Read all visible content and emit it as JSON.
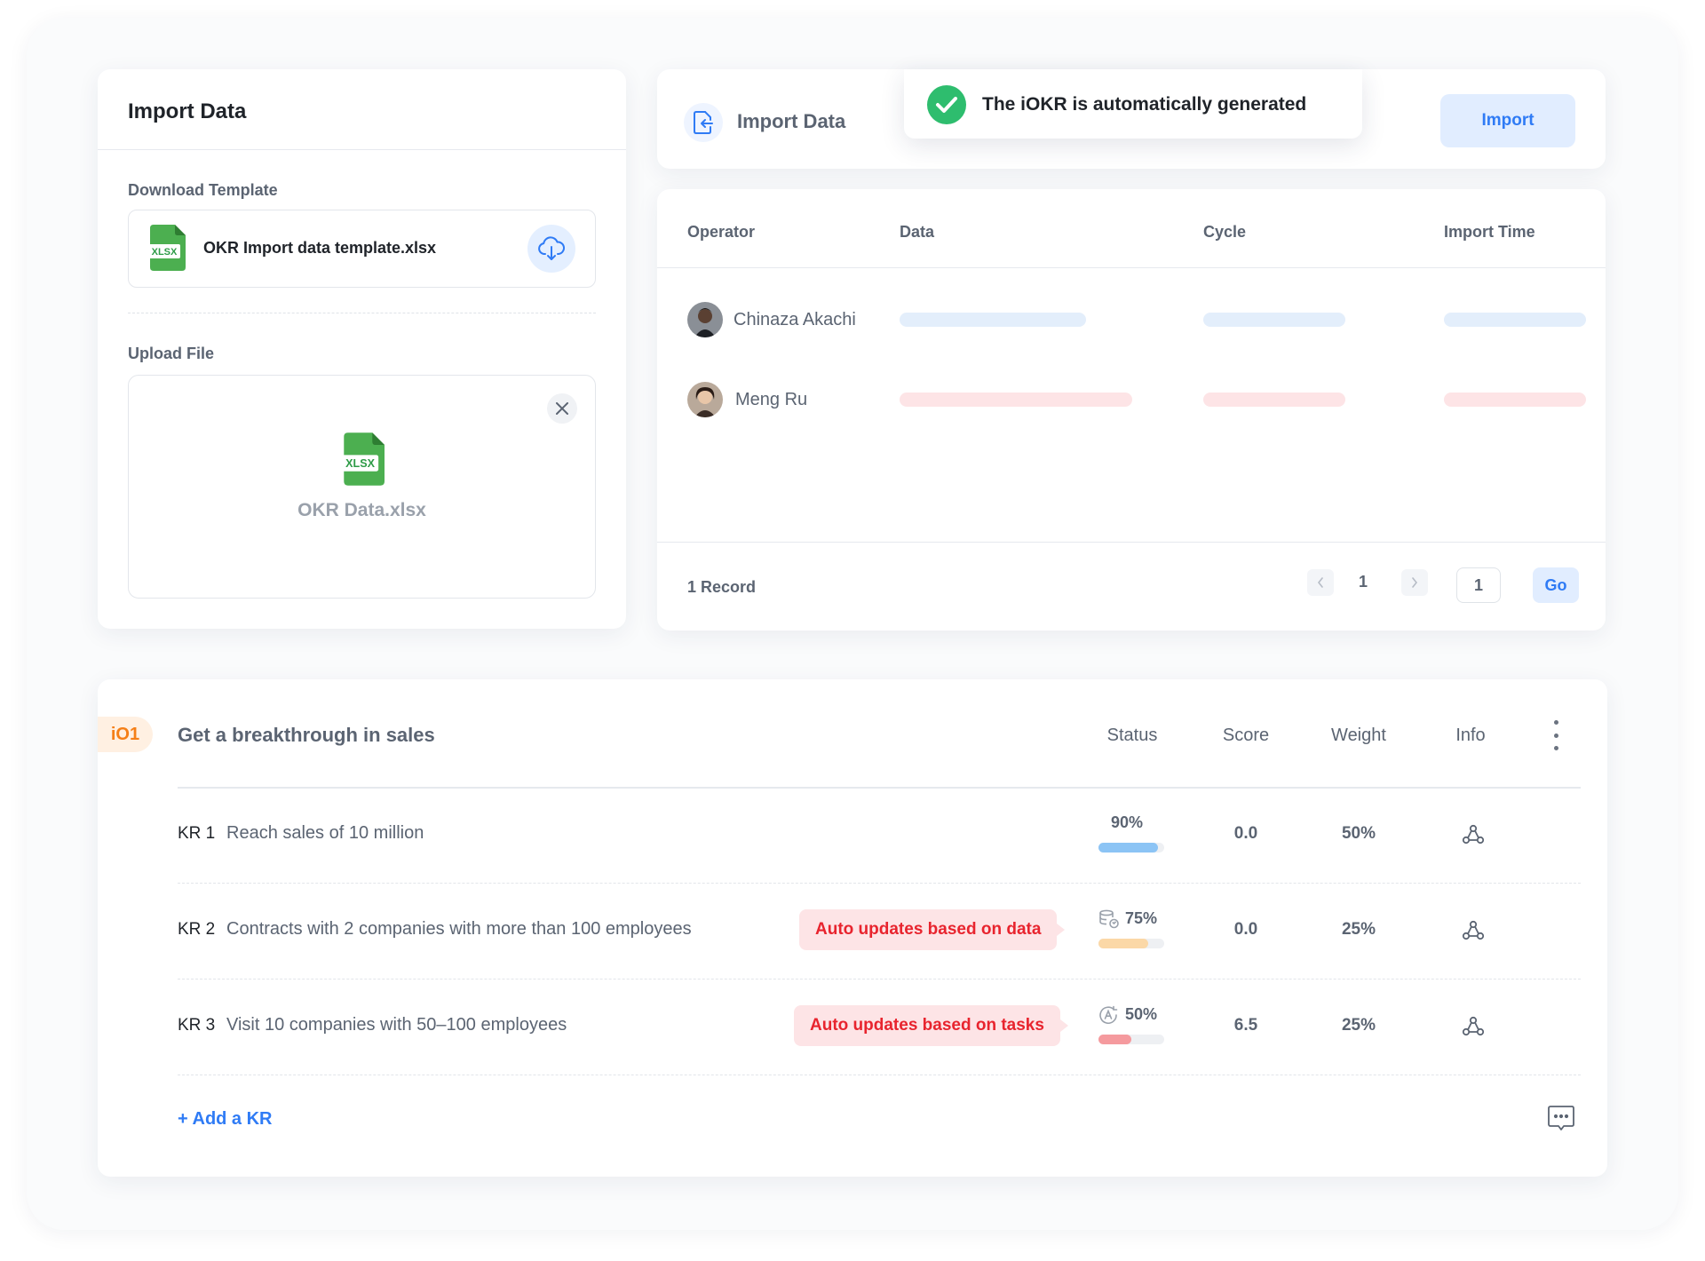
{
  "colors": {
    "accent": "#2f7bf5",
    "success": "#2ebd6e",
    "danger": "#e8242e",
    "objective_badge": "#f57f17",
    "progress_blue": "#8cc4f5",
    "progress_orange": "#fbd8a7",
    "progress_red": "#f59a9e"
  },
  "left_panel": {
    "title": "Import Data",
    "download_label": "Download Template",
    "template_icon": "xlsx-file-icon",
    "template_icon_text": "XLSX",
    "template_filename": "OKR Import data template.xlsx",
    "download_icon": "cloud-download-icon",
    "upload_label": "Upload File",
    "upload_icon_text": "XLSX",
    "upload_filename": "OKR Data.xlsx",
    "remove_icon": "close-icon"
  },
  "header": {
    "icon": "file-import-icon",
    "title": "Import Data",
    "import_button": "Import"
  },
  "toast": {
    "icon": "check-circle-icon",
    "message": "The iOKR is automatically generated"
  },
  "table": {
    "columns": [
      "Operator",
      "Data",
      "Cycle",
      "Import Time"
    ],
    "rows": [
      {
        "operator": "Chinaza Akachi",
        "tone": "blue"
      },
      {
        "operator": "Meng Ru",
        "tone": "pink"
      }
    ],
    "record_count": "1 Record",
    "pagination": {
      "prev_icon": "chevron-left-icon",
      "next_icon": "chevron-right-icon",
      "current": "1",
      "jump_value": "1",
      "go_label": "Go"
    }
  },
  "okr": {
    "badge": "iO1",
    "objective": "Get a breakthrough in sales",
    "columns": {
      "status": "Status",
      "score": "Score",
      "weight": "Weight",
      "info": "Info"
    },
    "more_icon": "more-vertical-icon",
    "krs": [
      {
        "label": "KR 1",
        "text": "Reach sales of 10 million",
        "auto_tag": "",
        "status_icon": "",
        "progress": "90%",
        "progress_fraction": 0.9,
        "progress_color": "#8cc4f5",
        "score": "0.0",
        "weight": "50%",
        "info_icon": "alignment-icon"
      },
      {
        "label": "KR 2",
        "text": "Contracts with 2 companies with more than 100 employees",
        "auto_tag": "Auto updates based on data",
        "status_icon": "database-sync-icon",
        "progress": "75%",
        "progress_fraction": 0.75,
        "progress_color": "#fbd8a7",
        "score": "0.0",
        "weight": "25%",
        "info_icon": "alignment-icon"
      },
      {
        "label": "KR 3",
        "text": "Visit 10 companies with 50–100 employees",
        "auto_tag": "Auto updates based on tasks",
        "status_icon": "auto-task-icon",
        "progress": "50%",
        "progress_fraction": 0.5,
        "progress_color": "#f59a9e",
        "score": "6.5",
        "weight": "25%",
        "info_icon": "alignment-icon"
      }
    ],
    "add_kr": "+ Add a KR",
    "comment_icon": "comment-icon"
  }
}
